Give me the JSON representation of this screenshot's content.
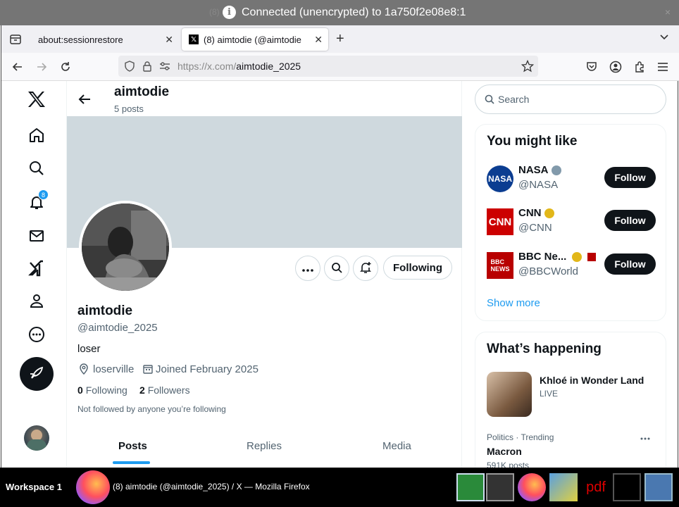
{
  "vnc": {
    "connection_text": "Connected (unencrypted) to 1a750f2e08e8:1",
    "ghost_text": "(8)",
    "close": "×"
  },
  "browser": {
    "tabs": [
      {
        "label": "about:sessionrestore",
        "active": false
      },
      {
        "label": "(8) aimtodie (@aimtodie",
        "active": true
      }
    ],
    "new_tab": "+",
    "url_host": "https://x.com/",
    "url_path": "aimtodie_2025"
  },
  "x_nav": {
    "notifications_badge": "8"
  },
  "profile": {
    "header_name": "aimtodie",
    "post_count": "5 posts",
    "name": "aimtodie",
    "handle": "@aimtodie_2025",
    "bio": "loser",
    "location": "loserville",
    "joined": "Joined February 2025",
    "following_count": "0",
    "following_label": "Following",
    "followers_count": "2",
    "followers_label": "Followers",
    "not_followed_text": "Not followed by anyone you’re following",
    "following_button": "Following",
    "tabs": [
      "Posts",
      "Replies",
      "Media"
    ]
  },
  "sidebar": {
    "search_placeholder": "Search",
    "might_like_title": "You might like",
    "accounts": [
      {
        "name": "NASA",
        "handle": "@NASA",
        "follow": "Follow",
        "badge_color": "#829aab"
      },
      {
        "name": "CNN",
        "handle": "@CNN",
        "follow": "Follow",
        "badge_color": "#e2b719"
      },
      {
        "name": "BBC Ne...",
        "handle": "@BBCWorld",
        "follow": "Follow",
        "badge_color": "#e2b719"
      }
    ],
    "show_more": "Show more",
    "happening_title": "What’s happening",
    "happening_item": {
      "title": "Khloé in Wonder Land",
      "status": "LIVE"
    },
    "trend": {
      "context": "Politics · Trending",
      "name": "Macron",
      "count": "591K posts"
    }
  },
  "taskbar": {
    "workspace": "Workspace 1",
    "window_title": "(8) aimtodie (@aimtodie_2025) / X — Mozilla Firefox"
  },
  "colors": {
    "accent": "#1d9bf0",
    "text": "#0f1419",
    "muted": "#536471"
  }
}
